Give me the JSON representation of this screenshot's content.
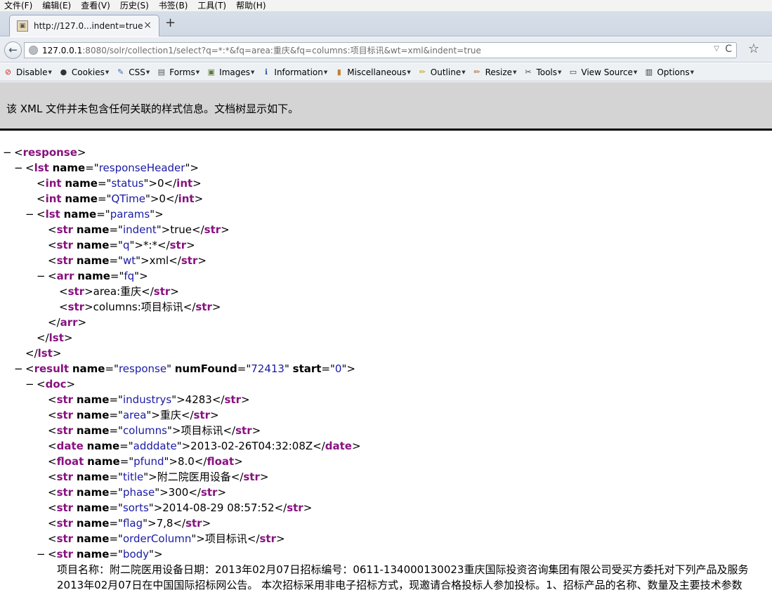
{
  "menubar": {
    "items": [
      "文件(F)",
      "编辑(E)",
      "查看(V)",
      "历史(S)",
      "书签(B)",
      "工具(T)",
      "帮助(H)"
    ]
  },
  "tab": {
    "title": "http://127.0...indent=true",
    "close": "×",
    "new_tab": "+"
  },
  "navbar": {
    "url_host": "127.0.0.1",
    "url_rest": ":8080/solr/collection1/select?q=*:*&fq=area:重庆&fq=columns:项目标讯&wt=xml&indent=true",
    "back": "←",
    "dropdown": "▽",
    "reload": "C",
    "bookmark": "☆"
  },
  "devbar": {
    "items": [
      {
        "label": "Disable",
        "icon": "disable-icon",
        "glyph": "⊘",
        "color": "#d42020"
      },
      {
        "label": "Cookies",
        "icon": "cookies-icon",
        "glyph": "●",
        "color": "#333333"
      },
      {
        "label": "CSS",
        "icon": "css-icon",
        "glyph": "✎",
        "color": "#3a6ab0"
      },
      {
        "label": "Forms",
        "icon": "forms-icon",
        "glyph": "▤",
        "color": "#555555"
      },
      {
        "label": "Images",
        "icon": "images-icon",
        "glyph": "▣",
        "color": "#5a7a3a"
      },
      {
        "label": "Information",
        "icon": "information-icon",
        "glyph": "ℹ",
        "color": "#2a5aa8"
      },
      {
        "label": "Miscellaneous",
        "icon": "miscellaneous-icon",
        "glyph": "▮",
        "color": "#c08030"
      },
      {
        "label": "Outline",
        "icon": "outline-icon",
        "glyph": "✏",
        "color": "#c0a020"
      },
      {
        "label": "Resize",
        "icon": "resize-icon",
        "glyph": "✏",
        "color": "#b06020"
      },
      {
        "label": "Tools",
        "icon": "tools-icon",
        "glyph": "✂",
        "color": "#444444"
      },
      {
        "label": "View Source",
        "icon": "view-source-icon",
        "glyph": "▭",
        "color": "#333333"
      },
      {
        "label": "Options",
        "icon": "options-icon",
        "glyph": "▥",
        "color": "#333333"
      }
    ]
  },
  "infobar": {
    "message": "该 XML 文件并未包含任何关联的样式信息。文档树显示如下。"
  },
  "xml": {
    "lines": [
      {
        "indent": 0,
        "toggle": "−",
        "parts": [
          [
            "pun",
            "<"
          ],
          [
            "tag",
            "response"
          ],
          [
            "pun",
            ">"
          ]
        ]
      },
      {
        "indent": 1,
        "toggle": "−",
        "parts": [
          [
            "pun",
            "<"
          ],
          [
            "tag",
            "lst"
          ],
          [
            "pun",
            " "
          ],
          [
            "attr",
            "name"
          ],
          [
            "pun",
            "=\""
          ],
          [
            "val",
            "responseHeader"
          ],
          [
            "pun",
            "\">"
          ]
        ]
      },
      {
        "indent": 2,
        "toggle": "",
        "parts": [
          [
            "pun",
            "<"
          ],
          [
            "tag",
            "int"
          ],
          [
            "pun",
            " "
          ],
          [
            "attr",
            "name"
          ],
          [
            "pun",
            "=\""
          ],
          [
            "val",
            "status"
          ],
          [
            "pun",
            "\">"
          ],
          [
            "txt",
            "0"
          ],
          [
            "pun",
            "</"
          ],
          [
            "tag",
            "int"
          ],
          [
            "pun",
            ">"
          ]
        ]
      },
      {
        "indent": 2,
        "toggle": "",
        "parts": [
          [
            "pun",
            "<"
          ],
          [
            "tag",
            "int"
          ],
          [
            "pun",
            " "
          ],
          [
            "attr",
            "name"
          ],
          [
            "pun",
            "=\""
          ],
          [
            "val",
            "QTime"
          ],
          [
            "pun",
            "\">"
          ],
          [
            "txt",
            "0"
          ],
          [
            "pun",
            "</"
          ],
          [
            "tag",
            "int"
          ],
          [
            "pun",
            ">"
          ]
        ]
      },
      {
        "indent": 2,
        "toggle": "−",
        "parts": [
          [
            "pun",
            "<"
          ],
          [
            "tag",
            "lst"
          ],
          [
            "pun",
            " "
          ],
          [
            "attr",
            "name"
          ],
          [
            "pun",
            "=\""
          ],
          [
            "val",
            "params"
          ],
          [
            "pun",
            "\">"
          ]
        ]
      },
      {
        "indent": 3,
        "toggle": "",
        "parts": [
          [
            "pun",
            "<"
          ],
          [
            "tag",
            "str"
          ],
          [
            "pun",
            " "
          ],
          [
            "attr",
            "name"
          ],
          [
            "pun",
            "=\""
          ],
          [
            "val",
            "indent"
          ],
          [
            "pun",
            "\">"
          ],
          [
            "txt",
            "true"
          ],
          [
            "pun",
            "</"
          ],
          [
            "tag",
            "str"
          ],
          [
            "pun",
            ">"
          ]
        ]
      },
      {
        "indent": 3,
        "toggle": "",
        "parts": [
          [
            "pun",
            "<"
          ],
          [
            "tag",
            "str"
          ],
          [
            "pun",
            " "
          ],
          [
            "attr",
            "name"
          ],
          [
            "pun",
            "=\""
          ],
          [
            "val",
            "q"
          ],
          [
            "pun",
            "\">"
          ],
          [
            "txt",
            "*:*"
          ],
          [
            "pun",
            "</"
          ],
          [
            "tag",
            "str"
          ],
          [
            "pun",
            ">"
          ]
        ]
      },
      {
        "indent": 3,
        "toggle": "",
        "parts": [
          [
            "pun",
            "<"
          ],
          [
            "tag",
            "str"
          ],
          [
            "pun",
            " "
          ],
          [
            "attr",
            "name"
          ],
          [
            "pun",
            "=\""
          ],
          [
            "val",
            "wt"
          ],
          [
            "pun",
            "\">"
          ],
          [
            "txt",
            "xml"
          ],
          [
            "pun",
            "</"
          ],
          [
            "tag",
            "str"
          ],
          [
            "pun",
            ">"
          ]
        ]
      },
      {
        "indent": 3,
        "toggle": "−",
        "parts": [
          [
            "pun",
            "<"
          ],
          [
            "tag",
            "arr"
          ],
          [
            "pun",
            " "
          ],
          [
            "attr",
            "name"
          ],
          [
            "pun",
            "=\""
          ],
          [
            "val",
            "fq"
          ],
          [
            "pun",
            "\">"
          ]
        ]
      },
      {
        "indent": 4,
        "toggle": "",
        "parts": [
          [
            "pun",
            "<"
          ],
          [
            "tag",
            "str"
          ],
          [
            "pun",
            ">"
          ],
          [
            "txt",
            "area:重庆"
          ],
          [
            "pun",
            "</"
          ],
          [
            "tag",
            "str"
          ],
          [
            "pun",
            ">"
          ]
        ]
      },
      {
        "indent": 4,
        "toggle": "",
        "parts": [
          [
            "pun",
            "<"
          ],
          [
            "tag",
            "str"
          ],
          [
            "pun",
            ">"
          ],
          [
            "txt",
            "columns:项目标讯"
          ],
          [
            "pun",
            "</"
          ],
          [
            "tag",
            "str"
          ],
          [
            "pun",
            ">"
          ]
        ]
      },
      {
        "indent": 3,
        "toggle": "",
        "parts": [
          [
            "pun",
            "</"
          ],
          [
            "tag",
            "arr"
          ],
          [
            "pun",
            ">"
          ]
        ]
      },
      {
        "indent": 2,
        "toggle": "",
        "parts": [
          [
            "pun",
            "</"
          ],
          [
            "tag",
            "lst"
          ],
          [
            "pun",
            ">"
          ]
        ]
      },
      {
        "indent": 1,
        "toggle": "",
        "parts": [
          [
            "pun",
            "</"
          ],
          [
            "tag",
            "lst"
          ],
          [
            "pun",
            ">"
          ]
        ]
      },
      {
        "indent": 1,
        "toggle": "−",
        "parts": [
          [
            "pun",
            "<"
          ],
          [
            "tag",
            "result"
          ],
          [
            "pun",
            " "
          ],
          [
            "attr",
            "name"
          ],
          [
            "pun",
            "=\""
          ],
          [
            "val",
            "response"
          ],
          [
            "pun",
            "\" "
          ],
          [
            "attr",
            "numFound"
          ],
          [
            "pun",
            "=\""
          ],
          [
            "val",
            "72413"
          ],
          [
            "pun",
            "\" "
          ],
          [
            "attr",
            "start"
          ],
          [
            "pun",
            "=\""
          ],
          [
            "val",
            "0"
          ],
          [
            "pun",
            "\">"
          ]
        ]
      },
      {
        "indent": 2,
        "toggle": "−",
        "parts": [
          [
            "pun",
            "<"
          ],
          [
            "tag",
            "doc"
          ],
          [
            "pun",
            ">"
          ]
        ]
      },
      {
        "indent": 3,
        "toggle": "",
        "parts": [
          [
            "pun",
            "<"
          ],
          [
            "tag",
            "str"
          ],
          [
            "pun",
            " "
          ],
          [
            "attr",
            "name"
          ],
          [
            "pun",
            "=\""
          ],
          [
            "val",
            "industrys"
          ],
          [
            "pun",
            "\">"
          ],
          [
            "txt",
            "4283"
          ],
          [
            "pun",
            "</"
          ],
          [
            "tag",
            "str"
          ],
          [
            "pun",
            ">"
          ]
        ]
      },
      {
        "indent": 3,
        "toggle": "",
        "parts": [
          [
            "pun",
            "<"
          ],
          [
            "tag",
            "str"
          ],
          [
            "pun",
            " "
          ],
          [
            "attr",
            "name"
          ],
          [
            "pun",
            "=\""
          ],
          [
            "val",
            "area"
          ],
          [
            "pun",
            "\">"
          ],
          [
            "txt",
            "重庆"
          ],
          [
            "pun",
            "</"
          ],
          [
            "tag",
            "str"
          ],
          [
            "pun",
            ">"
          ]
        ]
      },
      {
        "indent": 3,
        "toggle": "",
        "parts": [
          [
            "pun",
            "<"
          ],
          [
            "tag",
            "str"
          ],
          [
            "pun",
            " "
          ],
          [
            "attr",
            "name"
          ],
          [
            "pun",
            "=\""
          ],
          [
            "val",
            "columns"
          ],
          [
            "pun",
            "\">"
          ],
          [
            "txt",
            "项目标讯"
          ],
          [
            "pun",
            "</"
          ],
          [
            "tag",
            "str"
          ],
          [
            "pun",
            ">"
          ]
        ]
      },
      {
        "indent": 3,
        "toggle": "",
        "parts": [
          [
            "pun",
            "<"
          ],
          [
            "tag",
            "date"
          ],
          [
            "pun",
            " "
          ],
          [
            "attr",
            "name"
          ],
          [
            "pun",
            "=\""
          ],
          [
            "val",
            "adddate"
          ],
          [
            "pun",
            "\">"
          ],
          [
            "txt",
            "2013-02-26T04:32:08Z"
          ],
          [
            "pun",
            "</"
          ],
          [
            "tag",
            "date"
          ],
          [
            "pun",
            ">"
          ]
        ]
      },
      {
        "indent": 3,
        "toggle": "",
        "parts": [
          [
            "pun",
            "<"
          ],
          [
            "tag",
            "float"
          ],
          [
            "pun",
            " "
          ],
          [
            "attr",
            "name"
          ],
          [
            "pun",
            "=\""
          ],
          [
            "val",
            "pfund"
          ],
          [
            "pun",
            "\">"
          ],
          [
            "txt",
            "8.0"
          ],
          [
            "pun",
            "</"
          ],
          [
            "tag",
            "float"
          ],
          [
            "pun",
            ">"
          ]
        ]
      },
      {
        "indent": 3,
        "toggle": "",
        "parts": [
          [
            "pun",
            "<"
          ],
          [
            "tag",
            "str"
          ],
          [
            "pun",
            " "
          ],
          [
            "attr",
            "name"
          ],
          [
            "pun",
            "=\""
          ],
          [
            "val",
            "title"
          ],
          [
            "pun",
            "\">"
          ],
          [
            "txt",
            "附二院医用设备"
          ],
          [
            "pun",
            "</"
          ],
          [
            "tag",
            "str"
          ],
          [
            "pun",
            ">"
          ]
        ]
      },
      {
        "indent": 3,
        "toggle": "",
        "parts": [
          [
            "pun",
            "<"
          ],
          [
            "tag",
            "str"
          ],
          [
            "pun",
            " "
          ],
          [
            "attr",
            "name"
          ],
          [
            "pun",
            "=\""
          ],
          [
            "val",
            "phase"
          ],
          [
            "pun",
            "\">"
          ],
          [
            "txt",
            "300"
          ],
          [
            "pun",
            "</"
          ],
          [
            "tag",
            "str"
          ],
          [
            "pun",
            ">"
          ]
        ]
      },
      {
        "indent": 3,
        "toggle": "",
        "parts": [
          [
            "pun",
            "<"
          ],
          [
            "tag",
            "str"
          ],
          [
            "pun",
            " "
          ],
          [
            "attr",
            "name"
          ],
          [
            "pun",
            "=\""
          ],
          [
            "val",
            "sorts"
          ],
          [
            "pun",
            "\">"
          ],
          [
            "txt",
            "2014-08-29 08:57:52"
          ],
          [
            "pun",
            "</"
          ],
          [
            "tag",
            "str"
          ],
          [
            "pun",
            ">"
          ]
        ]
      },
      {
        "indent": 3,
        "toggle": "",
        "parts": [
          [
            "pun",
            "<"
          ],
          [
            "tag",
            "str"
          ],
          [
            "pun",
            " "
          ],
          [
            "attr",
            "name"
          ],
          [
            "pun",
            "=\""
          ],
          [
            "val",
            "flag"
          ],
          [
            "pun",
            "\">"
          ],
          [
            "txt",
            "7,8"
          ],
          [
            "pun",
            "</"
          ],
          [
            "tag",
            "str"
          ],
          [
            "pun",
            ">"
          ]
        ]
      },
      {
        "indent": 3,
        "toggle": "",
        "parts": [
          [
            "pun",
            "<"
          ],
          [
            "tag",
            "str"
          ],
          [
            "pun",
            " "
          ],
          [
            "attr",
            "name"
          ],
          [
            "pun",
            "=\""
          ],
          [
            "val",
            "orderColumn"
          ],
          [
            "pun",
            "\">"
          ],
          [
            "txt",
            "项目标讯"
          ],
          [
            "pun",
            "</"
          ],
          [
            "tag",
            "str"
          ],
          [
            "pun",
            ">"
          ]
        ]
      },
      {
        "indent": 3,
        "toggle": "−",
        "parts": [
          [
            "pun",
            "<"
          ],
          [
            "tag",
            "str"
          ],
          [
            "pun",
            " "
          ],
          [
            "attr",
            "name"
          ],
          [
            "pun",
            "=\""
          ],
          [
            "val",
            "body"
          ],
          [
            "pun",
            "\">"
          ]
        ]
      }
    ],
    "body_lines": [
      "项目名称：附二院医用设备日期：2013年02月07日招标编号：0611-134000130023重庆国际投资咨询集团有限公司受买方委托对下列产品及服务",
      "2013年02月07日在中国国际招标网公告。 本次招标采用非电子招标方式，现邀请合格投标人参加投标。1、招标产品的名称、数量及主要技术参数"
    ]
  }
}
